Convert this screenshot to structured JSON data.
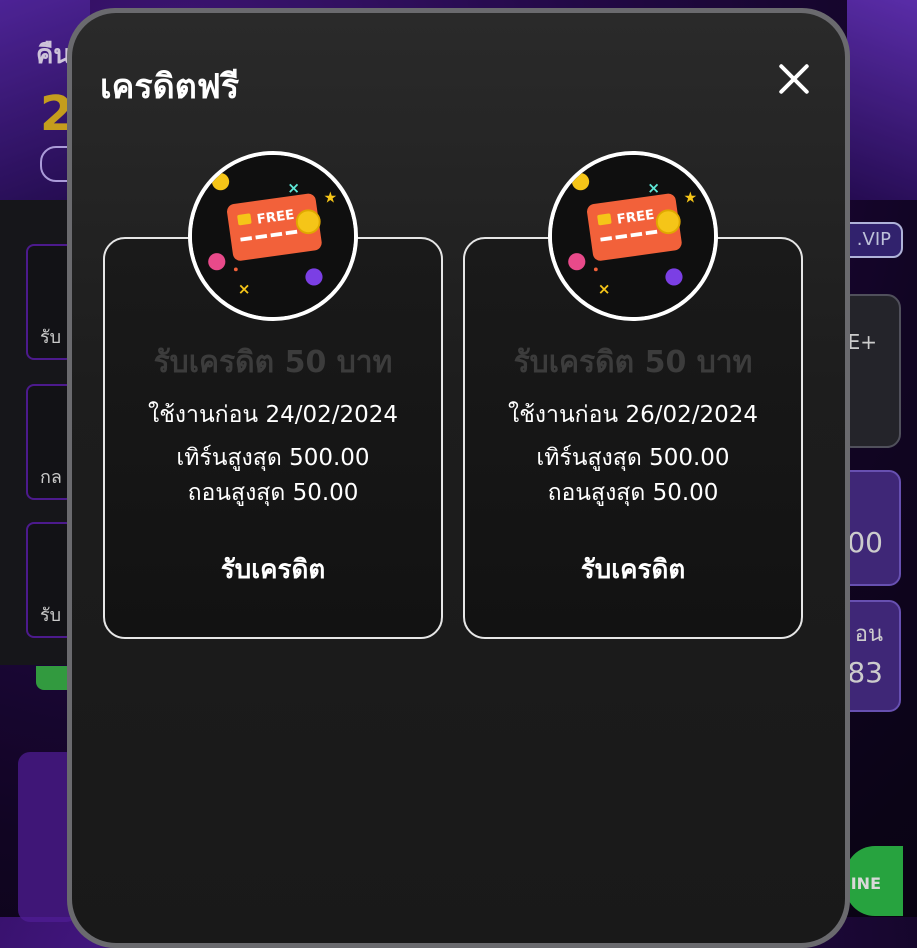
{
  "background": {
    "left_banner_text": "คืน",
    "left_banner_number": "2",
    "side_labels": [
      "รับ",
      "กล",
      "รับ"
    ],
    "vip_badge": ".VIP",
    "right_card1_text": "E+",
    "right_card2_text": "00",
    "right_card3_top": "อน",
    "right_card3_bottom": "83",
    "line_badge": "INE"
  },
  "modal": {
    "title": "เครดิตฟรี",
    "close_icon": "close-icon",
    "cards": [
      {
        "icon": "free-credit-card-icon",
        "icon_label": "FREE",
        "heading": "รับเครดิต 50 บาท",
        "expire": "ใช้งานก่อน 24/02/2024",
        "turnover": "เทิร์นสูงสุด 500.00",
        "withdraw": "ถอนสูงสุด 50.00",
        "button": "รับเครดิต"
      },
      {
        "icon": "free-credit-card-icon",
        "icon_label": "FREE",
        "heading": "รับเครดิต 50 บาท",
        "expire": "ใช้งานก่อน 26/02/2024",
        "turnover": "เทิร์นสูงสุด 500.00",
        "withdraw": "ถอนสูงสุด 50.00",
        "button": "รับเครดิต"
      }
    ]
  },
  "colors": {
    "card_orange": "#f2613a",
    "coin_gold": "#f5c518",
    "border_white": "#ffffff",
    "heading_dim": "#3c3c3c"
  }
}
